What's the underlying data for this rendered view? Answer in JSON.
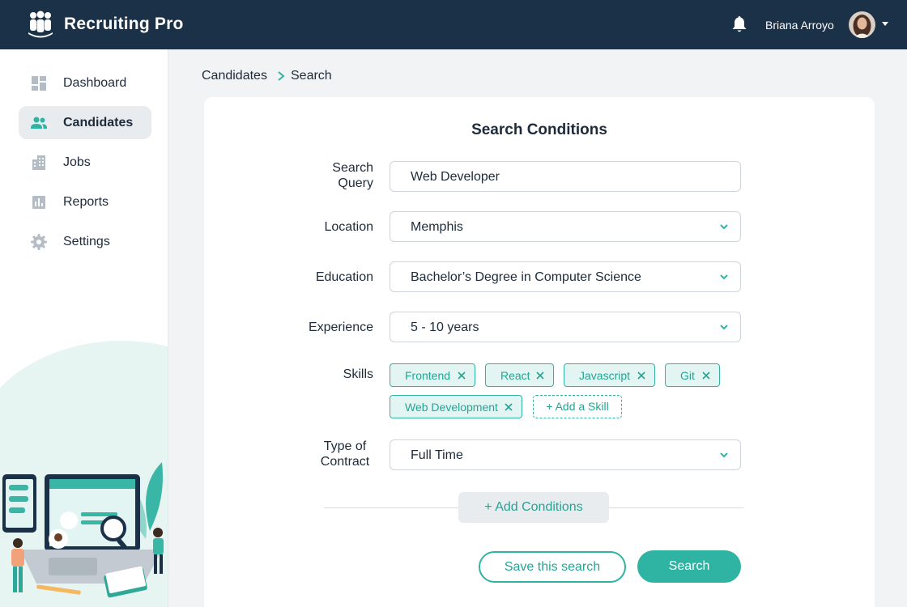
{
  "app": {
    "title": "Recruiting Pro"
  },
  "user": {
    "name": "Briana Arroyo"
  },
  "sidebar": {
    "items": [
      {
        "label": "Dashboard",
        "icon": "dashboard-icon"
      },
      {
        "label": "Candidates",
        "icon": "people-icon",
        "active": true
      },
      {
        "label": "Jobs",
        "icon": "building-icon"
      },
      {
        "label": "Reports",
        "icon": "bar-chart-icon"
      },
      {
        "label": "Settings",
        "icon": "gear-icon"
      }
    ]
  },
  "breadcrumb": {
    "parent": "Candidates",
    "current": "Search"
  },
  "search_conditions": {
    "title": "Search Conditions",
    "query": {
      "label": "Search Query",
      "value": "Web Developer"
    },
    "location": {
      "label": "Location",
      "value": "Memphis"
    },
    "education": {
      "label": "Education",
      "value": "Bachelor’s Degree in Computer Science"
    },
    "experience": {
      "label": "Experience",
      "value": "5 - 10 years"
    },
    "skills": {
      "label": "Skills",
      "items": [
        "Frontend",
        "React",
        "Javascript",
        "Git",
        "Web Development"
      ],
      "add_label": "+ Add a Skill"
    },
    "contract": {
      "label": "Type of Contract",
      "value": "Full Time"
    },
    "add_conditions_label": "+ Add Conditions"
  },
  "actions": {
    "save_label": "Save this search",
    "search_label": "Search"
  },
  "colors": {
    "header_bg": "#1b3147",
    "accent": "#2fb3a2",
    "chip_bg": "#e3f5f2"
  }
}
